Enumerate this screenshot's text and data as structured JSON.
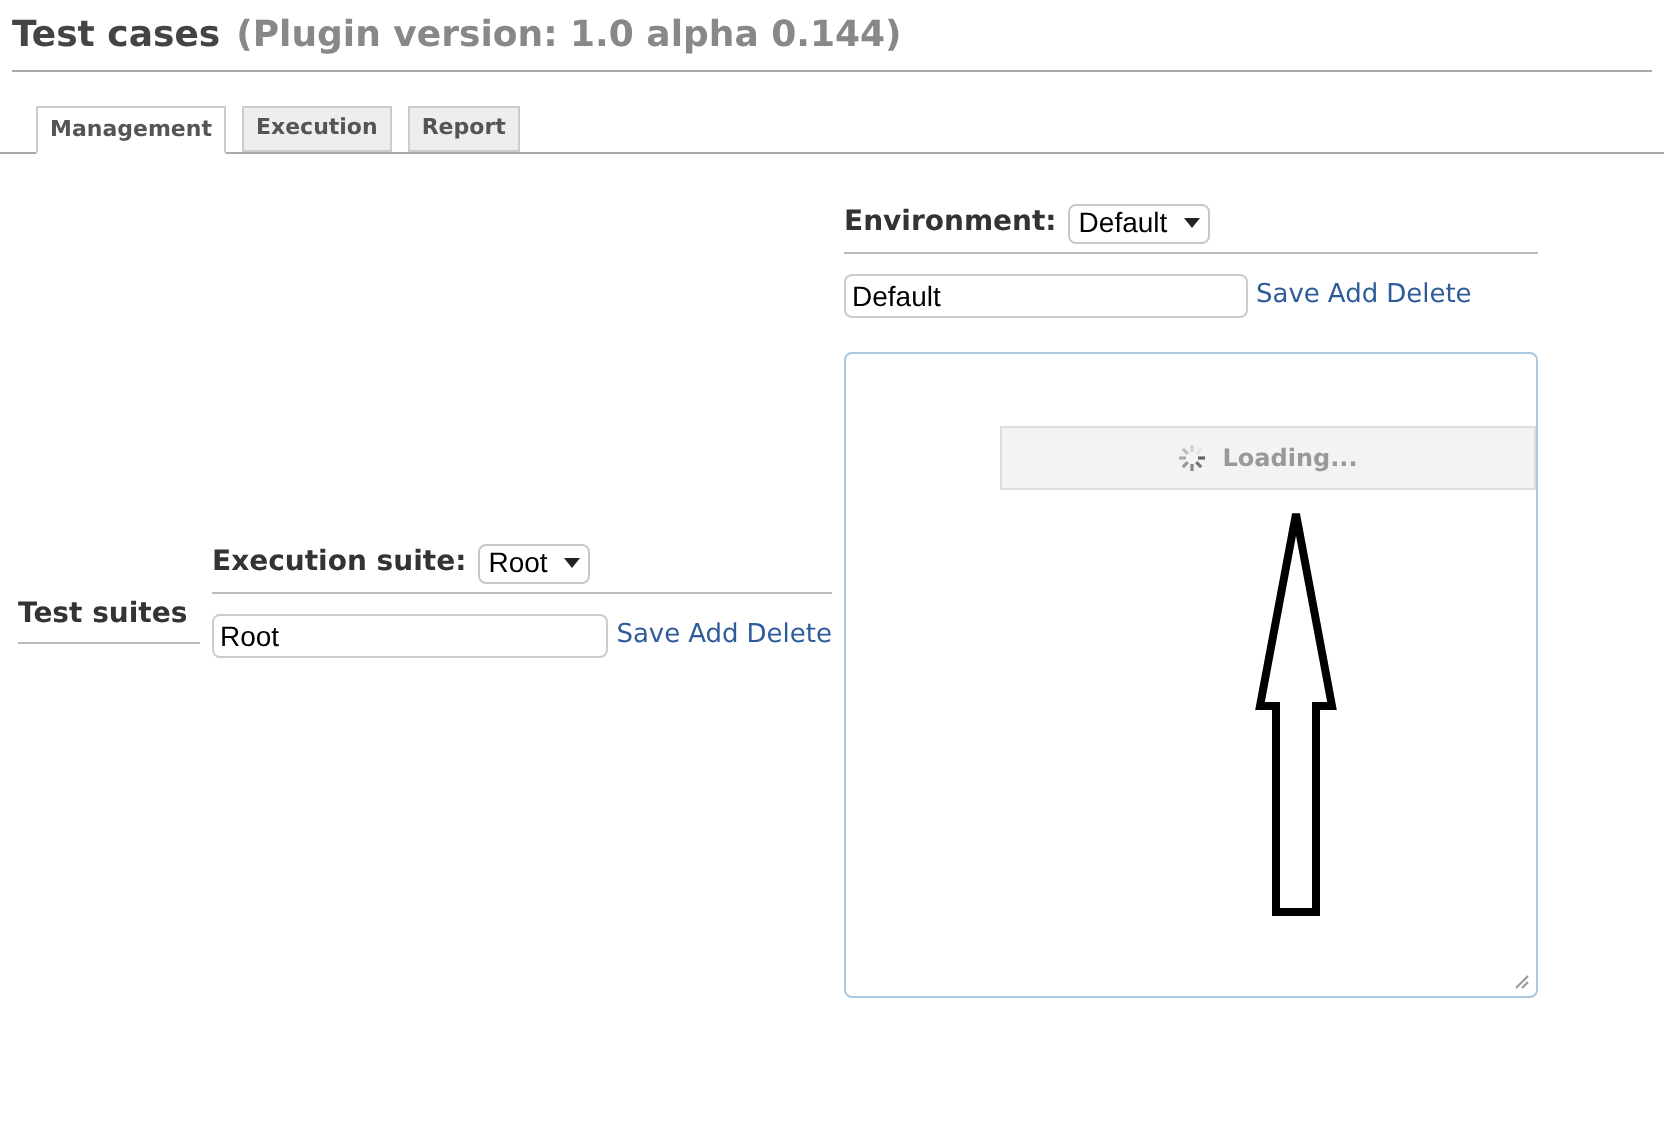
{
  "header": {
    "title": "Test cases",
    "subtitle": "(Plugin version: 1.0 alpha 0.144)"
  },
  "tabs": [
    {
      "label": "Management",
      "selected": true
    },
    {
      "label": "Execution",
      "selected": false
    },
    {
      "label": "Report",
      "selected": false
    }
  ],
  "test_suites": {
    "heading": "Test suites"
  },
  "execution_suite": {
    "label": "Execution suite:",
    "dropdown": "Root",
    "field": "Root",
    "links": [
      "Save",
      "Add",
      "Delete"
    ]
  },
  "environment": {
    "label": "Environment:",
    "dropdown": "Default",
    "field": "Default",
    "links": [
      "Save",
      "Add",
      "Delete"
    ]
  },
  "panel": {
    "loading": "Loading..."
  }
}
